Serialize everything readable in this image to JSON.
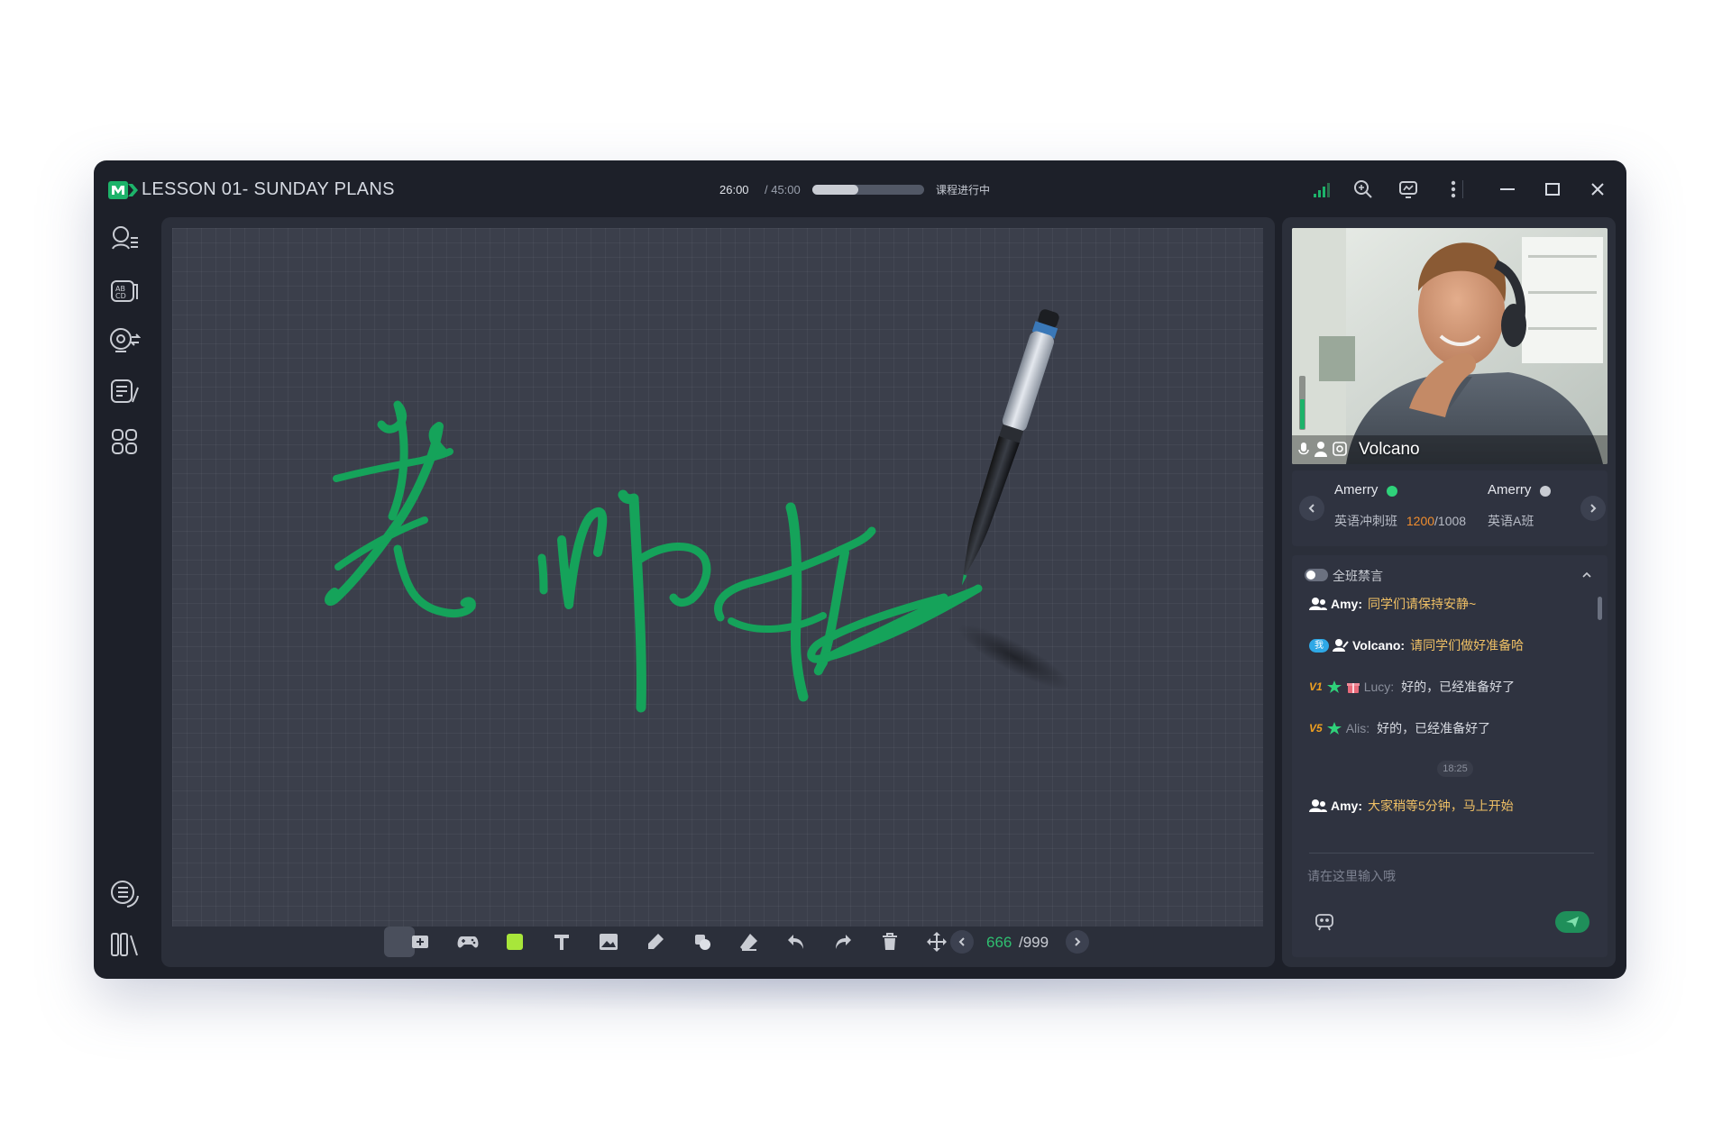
{
  "app": {
    "title": "LESSON 01- SUNDAY PLANS",
    "timer_elapsed": "26:00",
    "timer_total": "/ 45:00",
    "progress_fraction": 0.41,
    "course_status": "课程进行中",
    "accent_color": "#1db36a"
  },
  "titlebar_icons": [
    "signal-icon",
    "search-zoom-icon",
    "screen-share-icon",
    "more-vertical-icon",
    "minimize-icon",
    "maximize-icon",
    "close-icon"
  ],
  "left_rail": {
    "top_icons": [
      "user-list-icon",
      "vocabulary-card-icon",
      "camera-switch-icon",
      "quiz-edit-icon",
      "apps-grid-icon"
    ],
    "bottom_icons": [
      "lesson-list-icon",
      "library-icon"
    ]
  },
  "board": {
    "handwriting_color": "#15a35a",
    "toolbar_tools": [
      "select-tool-icon",
      "add-page-icon",
      "gamepad-icon",
      "color-swatch-icon",
      "text-tool-icon",
      "image-tool-icon",
      "pen-tool-icon",
      "shape-tool-icon",
      "eraser-tool-icon",
      "undo-icon",
      "redo-icon",
      "delete-icon",
      "move-icon"
    ],
    "swatch_color": "#a8e63a",
    "page_current": "666",
    "page_total": "/999"
  },
  "video": {
    "presenter_name": "Volcano"
  },
  "classes": [
    {
      "teacher": "Amerry",
      "status_color": "#2fd27a",
      "class_name": "英语冲刺班",
      "count_current": "1200",
      "count_total": "/1008"
    },
    {
      "teacher": "Amerry",
      "status_color": "#c9ccd3",
      "class_name": "英语A班"
    }
  ],
  "chat": {
    "mute_all_label": "全班禁言",
    "messages": [
      {
        "role": "teacher",
        "sender": "Amy:",
        "text": "同学们请保持安静~"
      },
      {
        "role": "teacher",
        "badge": "我",
        "sender": "Volcano:",
        "text": "请同学们做好准备哈"
      },
      {
        "role": "student",
        "level": "V1",
        "sender": "Lucy:",
        "text": "好的，已经准备好了"
      },
      {
        "role": "student",
        "level": "V5",
        "sender": "Alis:",
        "text": "好的，已经准备好了"
      },
      {
        "role": "teacher",
        "sender": "Amy:",
        "text": "大家稍等5分钟，马上开始"
      }
    ],
    "timestamp": "18:25",
    "input_placeholder": "请在这里输入哦"
  }
}
